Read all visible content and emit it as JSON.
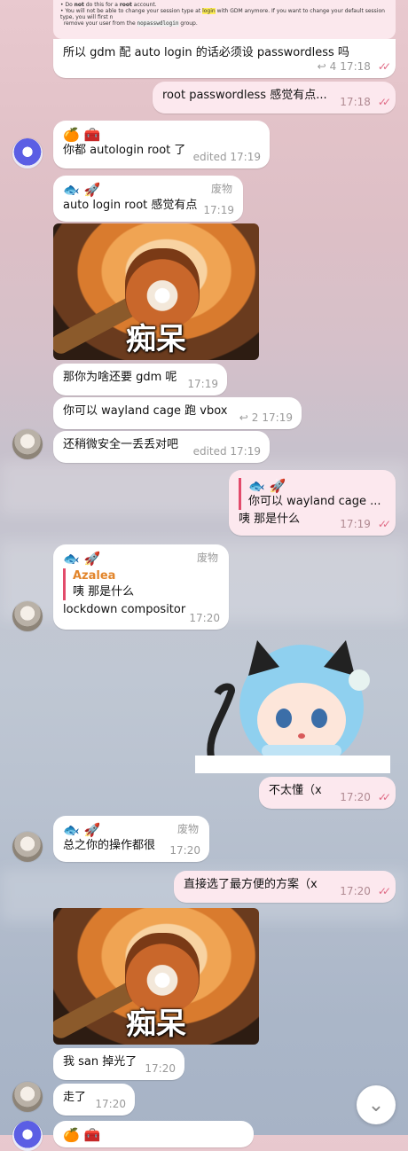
{
  "top_card": {
    "line1_a": "Do ",
    "line1_b": "not",
    "line1_c": " do this for a ",
    "line1_d": "root",
    "line1_e": " account.",
    "line2_a": "You will not be able to change your session type at ",
    "line2_b": "login",
    "line2_c": " with GDM anymore. If you want to change your default session type, you will first n",
    "line3_a": "remove your user from the ",
    "line3_b": "nopasswdlogin",
    "line3_c": " group."
  },
  "messages": [
    {
      "text": "所以 gdm 配 auto login 的话必须设 passwordless 吗",
      "replies": "4",
      "time": "17:18"
    },
    {
      "text": "root passwordless 感觉有点...",
      "time": "17:18"
    },
    {
      "emoji": "🍊 🧰",
      "text": "你都 autologin root 了",
      "time": "edited 17:19"
    },
    {
      "emoji": "🐟 🚀",
      "role": "废物",
      "text": "auto login root 感觉有点",
      "time": "17:19"
    },
    {
      "caption": "痴呆"
    },
    {
      "text": "那你为啥还要 gdm 呢",
      "time": "17:19"
    },
    {
      "text": "你可以 wayland cage 跑 vbox",
      "replies": "2",
      "time": "17:19"
    },
    {
      "text": "还稍微安全一丢丢对吧",
      "time": "edited 17:19"
    },
    {
      "quote_emoji": "🐟 🚀",
      "quote_text": "你可以 wayland cage ...",
      "text": "咦 那是什么",
      "time": "17:19"
    },
    {
      "emoji": "🐟 🚀",
      "role": "废物",
      "quote_name": "Azalea",
      "quote_text": "咦 那是什么",
      "text": "lockdown compositor",
      "time": "17:20"
    },
    {
      "text": "不太懂（x",
      "time": "17:20"
    },
    {
      "emoji": "🐟 🚀",
      "role": "废物",
      "text": "总之你的操作都很",
      "time": "17:20"
    },
    {
      "text": "直接选了最方便的方案（x",
      "time": "17:20"
    },
    {
      "caption": "痴呆"
    },
    {
      "text": "我 san 掉光了",
      "time": "17:20"
    },
    {
      "text": "走了",
      "time": "17:20"
    },
    {
      "emoji": "🍊 🧰"
    }
  ],
  "icons": {
    "reply": "reply-arrow-icon",
    "read": "double-check-icon",
    "scroll": "chevron-down-icon"
  },
  "colors": {
    "accent": "#e24b6b",
    "outgoing_bubble": "#fce8ee",
    "reply_name": "#e2852b"
  }
}
